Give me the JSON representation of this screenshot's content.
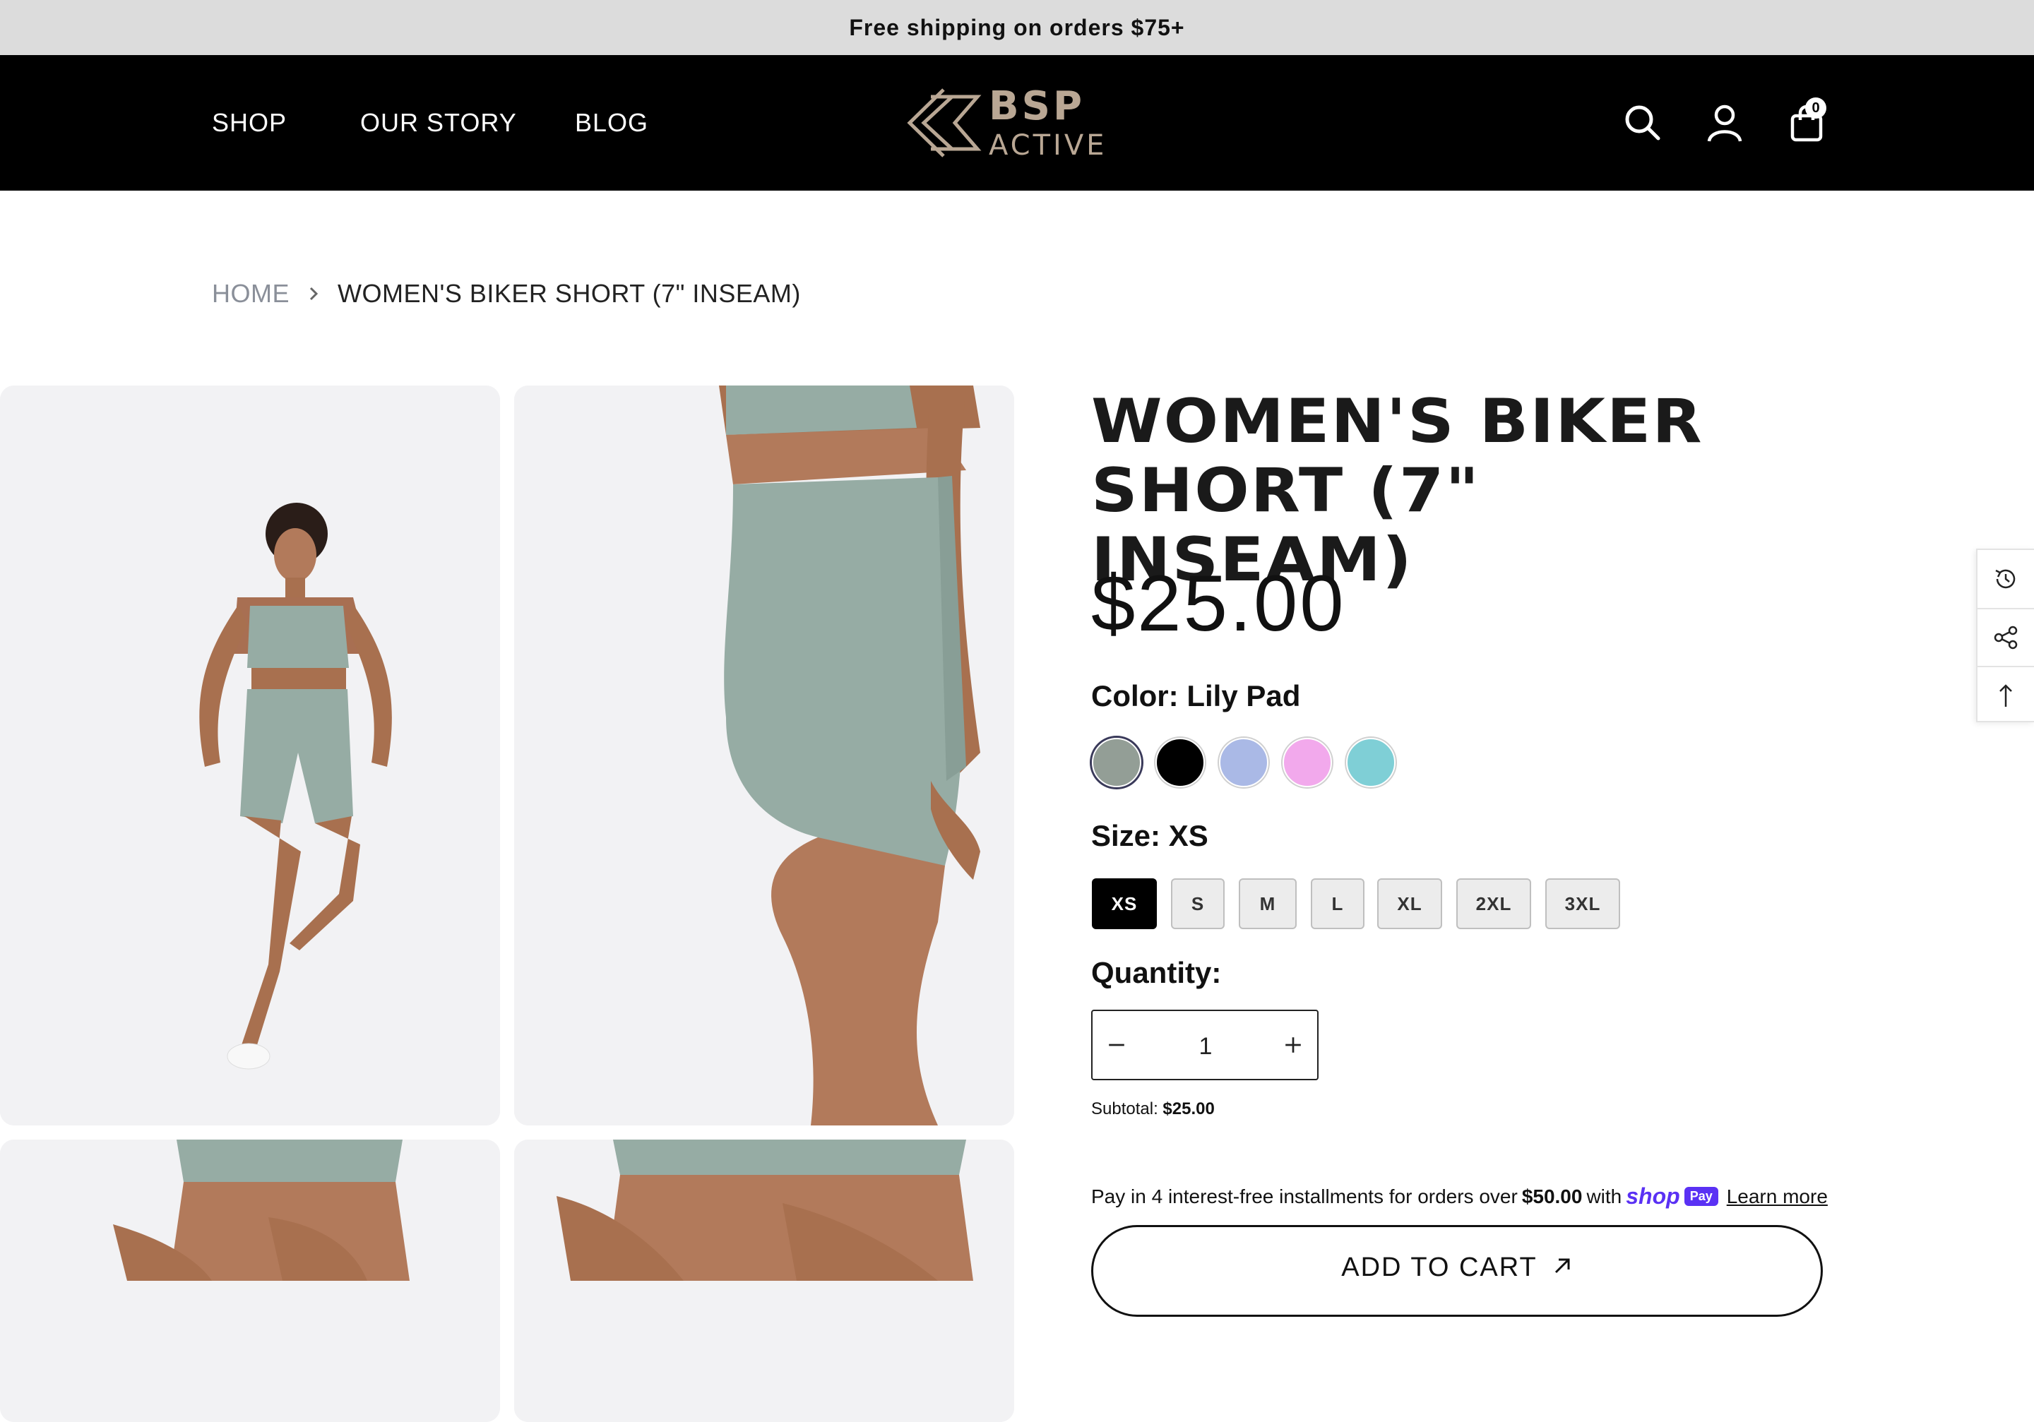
{
  "announcement": {
    "text": "Free shipping on orders $75+"
  },
  "header": {
    "nav": [
      "SHOP",
      "OUR STORY",
      "BLOG"
    ],
    "logo_text_top": "BSP",
    "logo_text_bottom": "ACTIVE",
    "cart_count": "0",
    "icons": [
      "search-icon",
      "account-icon",
      "cart-icon"
    ]
  },
  "breadcrumb": {
    "home": "HOME",
    "current": "WOMEN'S BIKER SHORT (7\" INSEAM)"
  },
  "product": {
    "title_line1": "WOMEN'S BIKER",
    "title_line2": "SHORT (7\" INSEAM)",
    "price": "$25.00",
    "color_label": "Color:",
    "color_value": "Lily Pad",
    "swatches": [
      "#939e96",
      "#000000",
      "#aab9e6",
      "#f2a9ec",
      "#7fcfd6"
    ],
    "size_label": "Size:",
    "size_value": "XS",
    "sizes": [
      "XS",
      "S",
      "M",
      "L",
      "XL",
      "2XL",
      "3XL"
    ],
    "quantity_label": "Quantity:",
    "quantity_value": "1",
    "subtotal_label": "Subtotal:",
    "subtotal_value": "$25.00",
    "installments_prefix": "Pay in 4 interest-free installments for orders over",
    "installments_amount": "$50.00",
    "installments_with": "with",
    "shoppay_shop": "shop",
    "shoppay_pay": "Pay",
    "learn_more": "Learn more",
    "add_to_cart": "ADD TO CART"
  },
  "side_tools": [
    "recently-viewed-icon",
    "share-icon",
    "back-to-top-icon"
  ],
  "colors": {
    "accent": "#5a31f4",
    "header_bg": "#000000",
    "product_color": "#96aca4"
  }
}
